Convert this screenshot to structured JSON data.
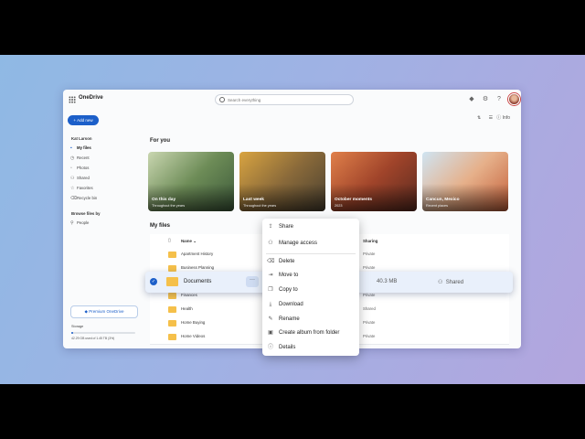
{
  "app": {
    "title": "OneDrive"
  },
  "search": {
    "placeholder": "Search everything"
  },
  "toolbar": {
    "info_label": "Info"
  },
  "sidebar": {
    "add_new": "Add new",
    "user_name": "Kat Larson",
    "items": [
      {
        "label": "My files",
        "icon": "folder-icon",
        "active": true
      },
      {
        "label": "Recent",
        "icon": "clock-icon",
        "active": false
      },
      {
        "label": "Photos",
        "icon": "image-icon",
        "active": false
      },
      {
        "label": "Shared",
        "icon": "people-icon",
        "active": false
      },
      {
        "label": "Favorites",
        "icon": "star-icon",
        "active": false
      },
      {
        "label": "Recycle bin",
        "icon": "trash-icon",
        "active": false
      }
    ],
    "browse_heading": "Browse files by",
    "browse_items": [
      {
        "label": "People",
        "icon": "person-icon"
      }
    ],
    "premium_label": "Premium OneDrive",
    "storage_label": "Storage",
    "storage_text": "42.29 GB used of 1.45 TB (3%)",
    "storage_fraction": 0.03
  },
  "for_you": {
    "heading": "For you",
    "cards": [
      {
        "title": "On this day",
        "subtitle": "Throughout the years",
        "colors": [
          "#c9d6b0",
          "#6d8c57",
          "#3d5a3a"
        ]
      },
      {
        "title": "Last week",
        "subtitle": "Throughout the years",
        "colors": [
          "#d9a441",
          "#8a6a3a",
          "#4a4030"
        ]
      },
      {
        "title": "October moments",
        "subtitle": "2023",
        "colors": [
          "#e0804a",
          "#a0442a",
          "#5a2a20"
        ]
      },
      {
        "title": "Cancun, Mexico",
        "subtitle": "Recent places",
        "colors": [
          "#cfe4f2",
          "#e6b08a",
          "#c4603a"
        ]
      }
    ]
  },
  "my_files": {
    "heading": "My files",
    "columns": {
      "name": "Name",
      "sharing": "Sharing"
    },
    "rows": [
      {
        "name": "Apartment History",
        "sharing": "Private"
      },
      {
        "name": "Business Planning",
        "sharing": "Private"
      },
      {
        "name": "",
        "sharing": ""
      },
      {
        "name": "Finances",
        "sharing": "Private"
      },
      {
        "name": "Health",
        "sharing": "Shared"
      },
      {
        "name": "Home Buying",
        "sharing": "Private"
      },
      {
        "name": "Home Videos",
        "sharing": "Private"
      }
    ],
    "selected": {
      "name": "Documents",
      "size": "40.3 MB",
      "sharing": "Shared",
      "more": "···"
    }
  },
  "context_menu": {
    "items": [
      {
        "label": "Share",
        "icon": "share-icon"
      },
      {
        "label": "Manage access",
        "icon": "manage-access-icon"
      },
      {
        "label": "Delete",
        "icon": "trash-icon"
      },
      {
        "label": "Move to",
        "icon": "move-icon"
      },
      {
        "label": "Copy to",
        "icon": "copy-icon"
      },
      {
        "label": "Download",
        "icon": "download-icon"
      },
      {
        "label": "Rename",
        "icon": "rename-icon"
      },
      {
        "label": "Create album from folder",
        "icon": "album-icon"
      },
      {
        "label": "Details",
        "icon": "info-icon"
      }
    ]
  }
}
